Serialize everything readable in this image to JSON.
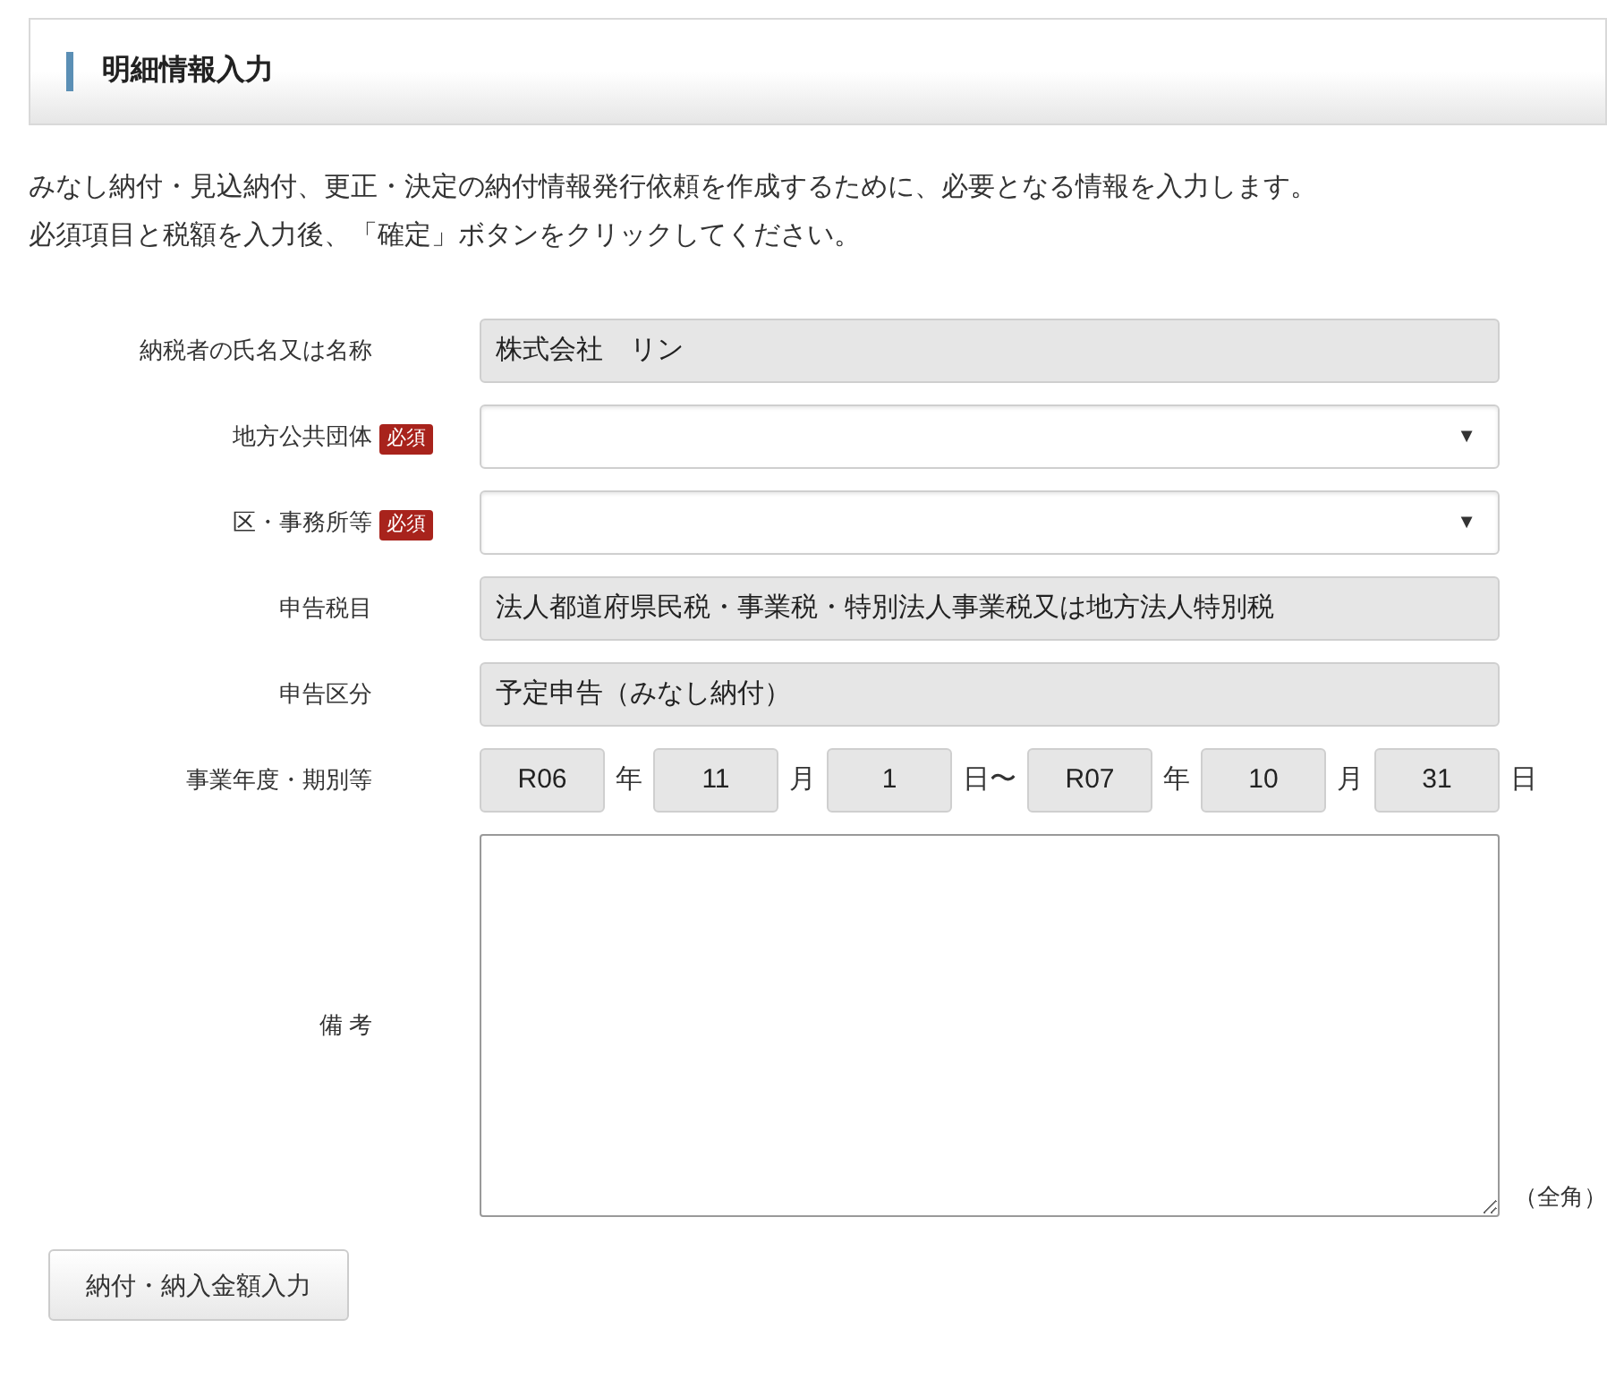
{
  "header": {
    "title": "明細情報入力"
  },
  "intro": [
    "みなし納付・見込納付、更正・決定の納付情報発行依頼を作成するために、必要となる情報を入力します。",
    "必須項目と税額を入力後、「確定」ボタンをクリックしてください。"
  ],
  "fields": [
    {
      "kind": "readonly",
      "label": "納税者の氏名又は名称",
      "value": "株式会社　リン"
    },
    {
      "kind": "select",
      "label": "地方公共団体",
      "required_badge": "必須",
      "value": "▼"
    },
    {
      "kind": "select",
      "label": "区・事務所等",
      "required_badge": "必須",
      "value": "▼"
    },
    {
      "kind": "readonly",
      "label": "申告税目",
      "value": "法人都道府県民税・事業税・特別法人事業税又は地方法人特別税"
    },
    {
      "kind": "readonly",
      "label": "申告区分",
      "value": "予定申告（みなし納付）"
    },
    {
      "kind": "period",
      "label": "事業年度・期別等",
      "parts": [
        {
          "kind": "box",
          "text": "R06"
        },
        {
          "kind": "unit",
          "text": "年"
        },
        {
          "kind": "box",
          "text": "11"
        },
        {
          "kind": "unit",
          "text": "月"
        },
        {
          "kind": "box",
          "text": "1"
        },
        {
          "kind": "unit",
          "text": "日〜"
        },
        {
          "kind": "box",
          "text": "R07"
        },
        {
          "kind": "unit",
          "text": "年"
        },
        {
          "kind": "box",
          "text": "10"
        },
        {
          "kind": "unit",
          "text": "月"
        },
        {
          "kind": "box",
          "text": "31"
        },
        {
          "kind": "unit",
          "text": "日"
        }
      ]
    },
    {
      "kind": "textarea",
      "label": "備 考",
      "note": "（全角）"
    }
  ],
  "button": {
    "label": "納付・納入金額入力"
  }
}
